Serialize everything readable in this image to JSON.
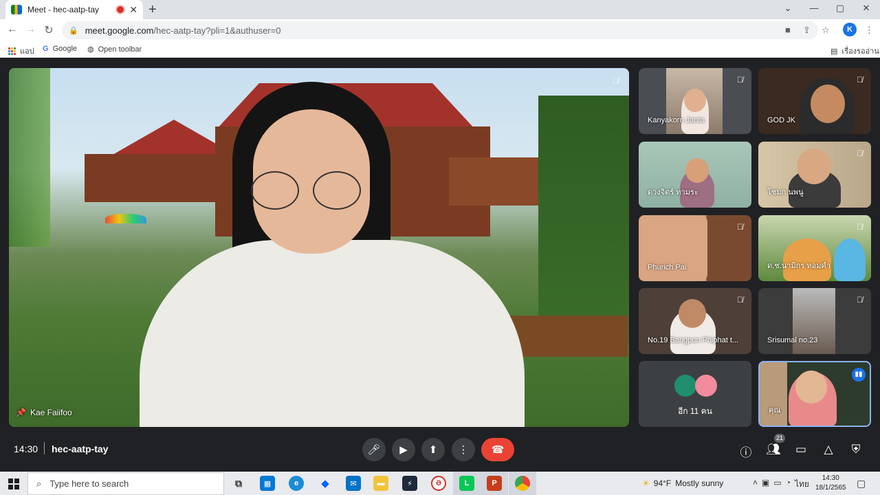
{
  "browser": {
    "tab_title": "Meet - hec-aatp-tay",
    "url_host": "meet.google.com",
    "url_path": "/hec-aatp-tay?pli=1&authuser=0",
    "profile_initial": "K",
    "bookmarks": [
      "แอป",
      "Google",
      "Open toolbar"
    ],
    "reading_list": "เรื่องรออ่าน"
  },
  "meeting": {
    "main_speaker": "Kae Faiifoo",
    "participants": [
      {
        "name": "Kanyakorn Janta"
      },
      {
        "name": "GOD JK"
      },
      {
        "name": "ดวงจิตร์ ทามระ"
      },
      {
        "name": "โชมก นพนู"
      },
      {
        "name": "Phurich Pai"
      },
      {
        "name": "ด.ช.นามิกร หอมคำ"
      },
      {
        "name": "No.19 Bangpun Phiphat t..."
      },
      {
        "name": "Srisumal no.23"
      },
      {
        "name": "คุณ"
      }
    ],
    "more_label": "อีก 11 คน",
    "time": "14:30",
    "code": "hec-aatp-tay",
    "participant_count": "21"
  },
  "taskbar": {
    "search_placeholder": "Type here to search",
    "weather_temp": "94°F",
    "weather_desc": "Mostly sunny",
    "lang": "ไทย",
    "time": "14:30",
    "date": "18/1/2565"
  }
}
